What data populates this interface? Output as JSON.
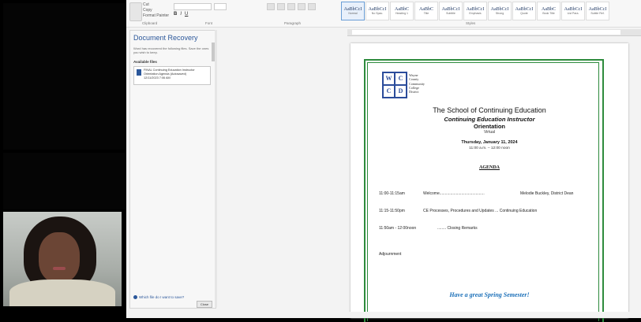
{
  "word": {
    "ribbon": {
      "clipboard": [
        "Cut",
        "Copy",
        "Format Painter"
      ],
      "styles": [
        "AaBbCcI",
        "AaBbCcI",
        "AaBbC",
        "AaBbC",
        "AaBbCcI",
        "AaBbCcI",
        "AaBbCcI",
        "AaBbCcI",
        "AaBbC",
        "AaBbCcI",
        "AaBbCcI",
        "AaBbCc"
      ],
      "groups": {
        "clipboard": "Clipboard",
        "font": "Font",
        "paragraph": "Paragraph",
        "styles": "Styles"
      }
    },
    "recovery": {
      "title": "Document Recovery",
      "description": "Word has recovered the following files. Save the ones you wish to keep.",
      "available": "Available files",
      "file_name": "FINAL Continuing Education Instructor Orientation Agenda (Autosaved)",
      "file_meta": "12/11/2023 7:06 AM",
      "help_link": "Which file do I want to save?",
      "close": "Close"
    },
    "document": {
      "logo_letters": [
        "W",
        "C",
        "C",
        "D"
      ],
      "logo_lines": [
        "Wayne",
        "County",
        "Community",
        "College",
        "District"
      ],
      "title": "The School of Continuing Education",
      "subtitle": "Continuing Education Instructor",
      "orientation": "Orientation",
      "virtual": "Virtual",
      "date": "Thursday, January 11, 2024",
      "time": "11:00 a.m. – 12:00 noon",
      "agenda": "AGENDA",
      "items": [
        {
          "time": "11:00-11:15am",
          "topic": "Welcome.........................................",
          "speaker": "Melodie Buckley, District Dean"
        },
        {
          "time": "11:15-11:50pm",
          "topic": "CE Processes, Procedures and Updates ... Continuing Education",
          "speaker": ""
        },
        {
          "time": "11:50am - 12:00noon",
          "topic": "........ Closing Remarks",
          "speaker": ""
        }
      ],
      "adjournment": "Adjournment",
      "closing": "Have a great Spring Semester!"
    }
  }
}
